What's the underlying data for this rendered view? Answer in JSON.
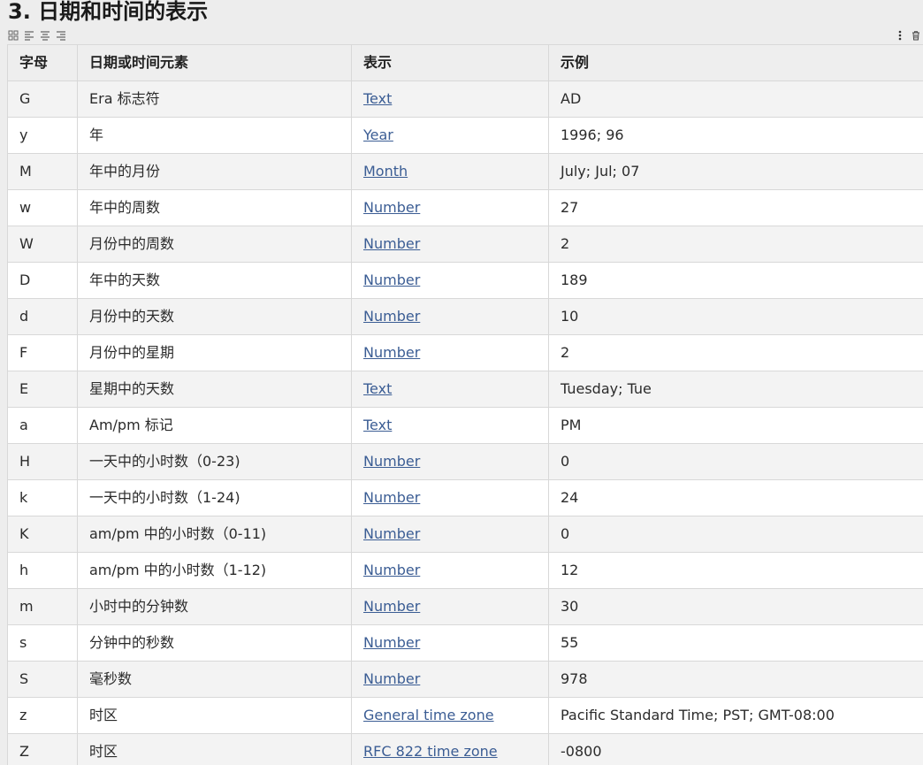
{
  "heading": "3. 日期和时间的表示",
  "toolbar": {
    "icons": [
      "grid-icon",
      "align-left-icon",
      "align-center-icon",
      "align-right-icon"
    ],
    "right_icons": [
      "more-vertical-icon",
      "delete-icon"
    ]
  },
  "table": {
    "headers": [
      "字母",
      "日期或时间元素",
      "表示",
      "示例"
    ],
    "rows": [
      {
        "letter": "G",
        "element": "Era 标志符",
        "rep": "Text",
        "example": "AD"
      },
      {
        "letter": "y",
        "element": "年",
        "rep": "Year",
        "example": "1996; 96"
      },
      {
        "letter": "M",
        "element": "年中的月份",
        "rep": "Month",
        "example": "July; Jul; 07"
      },
      {
        "letter": "w",
        "element": "年中的周数",
        "rep": "Number",
        "example": "27"
      },
      {
        "letter": "W",
        "element": "月份中的周数",
        "rep": "Number",
        "example": "2"
      },
      {
        "letter": "D",
        "element": "年中的天数",
        "rep": "Number",
        "example": "189"
      },
      {
        "letter": "d",
        "element": "月份中的天数",
        "rep": "Number",
        "example": "10"
      },
      {
        "letter": "F",
        "element": "月份中的星期",
        "rep": "Number",
        "example": "2"
      },
      {
        "letter": "E",
        "element": "星期中的天数",
        "rep": "Text",
        "example": "Tuesday; Tue"
      },
      {
        "letter": "a",
        "element": "Am/pm 标记",
        "rep": "Text",
        "example": "PM"
      },
      {
        "letter": "H",
        "element": "一天中的小时数（0-23)",
        "rep": "Number",
        "example": "0"
      },
      {
        "letter": "k",
        "element": "一天中的小时数（1-24)",
        "rep": "Number",
        "example": "24"
      },
      {
        "letter": "K",
        "element": "am/pm 中的小时数（0-11)",
        "rep": "Number",
        "example": "0"
      },
      {
        "letter": "h",
        "element": "am/pm 中的小时数（1-12)",
        "rep": "Number",
        "example": "12"
      },
      {
        "letter": "m",
        "element": "小时中的分钟数",
        "rep": "Number",
        "example": "30"
      },
      {
        "letter": "s",
        "element": "分钟中的秒数",
        "rep": "Number",
        "example": "55"
      },
      {
        "letter": "S",
        "element": "毫秒数",
        "rep": "Number",
        "example": "978"
      },
      {
        "letter": "z",
        "element": "时区",
        "rep": "General time zone",
        "example": "Pacific Standard Time; PST; GMT-08:00"
      },
      {
        "letter": "Z",
        "element": "时区",
        "rep": "RFC 822 time zone",
        "example": "-0800"
      }
    ]
  },
  "colors": {
    "link": "#3b5d94",
    "header_bg": "#eeeeee",
    "stripe": "#f3f3f3",
    "border": "#d8d8d8"
  }
}
